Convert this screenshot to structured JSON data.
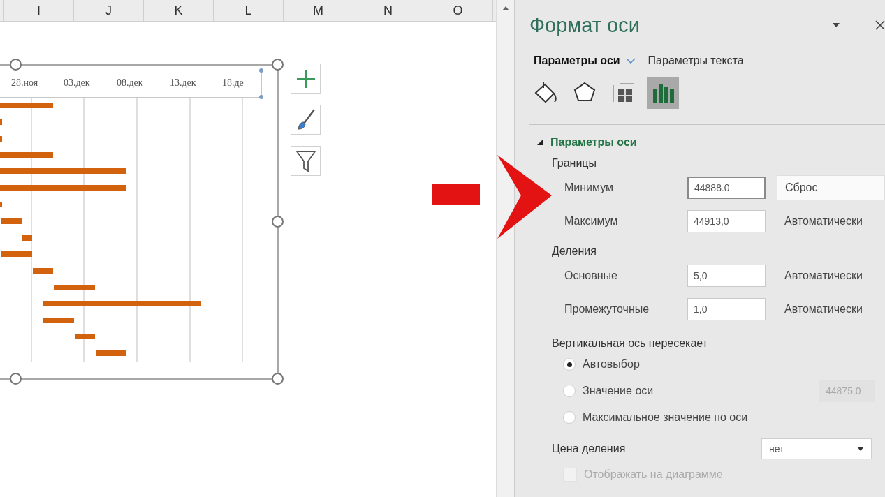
{
  "sheet": {
    "columns": [
      "I",
      "J",
      "K",
      "L",
      "M",
      "N",
      "O"
    ]
  },
  "chart": {
    "axis_labels": [
      "28.ноя",
      "03.дек",
      "08.дек",
      "13.дек",
      "18.де"
    ],
    "side_buttons": [
      {
        "kind": "add"
      },
      {
        "kind": "style"
      },
      {
        "kind": "filter"
      }
    ]
  },
  "panel": {
    "title": "Формат оси",
    "tabs": [
      {
        "label": "Параметры оси",
        "selected": true
      },
      {
        "label": "Параметры текста",
        "selected": false
      }
    ],
    "icon_tabs": [
      {
        "kind": "fill",
        "selected": false
      },
      {
        "kind": "effects",
        "selected": false
      },
      {
        "kind": "size",
        "selected": false
      },
      {
        "kind": "axis",
        "selected": true
      }
    ],
    "section": {
      "title": "Параметры оси",
      "expanded": true
    },
    "groups": [
      {
        "title": "Границы",
        "rows": [
          {
            "label": "Минимум",
            "value": "44888.0",
            "focused": true,
            "kind": "button",
            "action": "Сброс"
          },
          {
            "label": "Максимум",
            "value": "44913,0",
            "focused": false,
            "kind": "text",
            "action": "Автоматически"
          }
        ]
      },
      {
        "title": "Деления",
        "rows": [
          {
            "label": "Основные",
            "value": "5,0",
            "focused": false,
            "kind": "text",
            "action": "Автоматически"
          },
          {
            "label": "Промежуточные",
            "value": "1,0",
            "focused": false,
            "kind": "text",
            "action": "Автоматически"
          }
        ]
      }
    ],
    "crossing": {
      "title": "Вертикальная ось пересекает",
      "options": [
        {
          "label": "Автовыбор",
          "selected": true
        },
        {
          "label": "Значение оси",
          "selected": false,
          "value": "44875.0"
        },
        {
          "label": "Максимальное значение по оси",
          "selected": false
        }
      ]
    },
    "unit": {
      "label": "Цена деления",
      "value": "нет"
    },
    "checkbox": {
      "label": "Отображать на диаграмме",
      "checked": false,
      "disabled": true
    }
  }
}
